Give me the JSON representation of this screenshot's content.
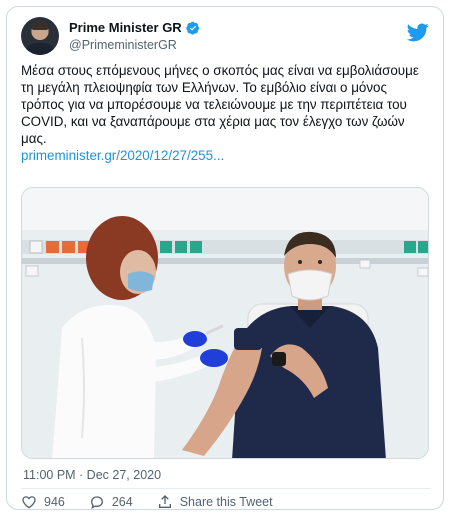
{
  "tweet": {
    "author_name": "Prime Minister GR",
    "author_handle": "@PrimeministerGR",
    "text": "Μέσα στους επόμενους μήνες ο σκοπός μας είναι να εμβολιάσουμε τη μεγάλη πλειοψηφία των Ελλήνων. Το εμβόλιο είναι ο μόνος τρόπος για να μπορέσουμε να τελειώνουμε με την περιπέτεια του COVID, και να ξαναπάρουμε στα χέρια μας τον έλεγχο των ζωών μας.",
    "link": "primeminister.gr/2020/12/27/255...",
    "timestamp": "11:00 PM · Dec 27, 2020"
  },
  "actions": {
    "likes": "946",
    "replies": "264",
    "share_label": "Share this Tweet"
  },
  "colors": {
    "twitter_blue": "#1d9bf0",
    "link_blue": "#1b95e0",
    "like_red": "#e0245e",
    "muted": "#536471"
  },
  "icons": [
    "verified-badge-icon",
    "twitter-bird-icon",
    "heart-icon",
    "reply-icon",
    "share-icon"
  ]
}
